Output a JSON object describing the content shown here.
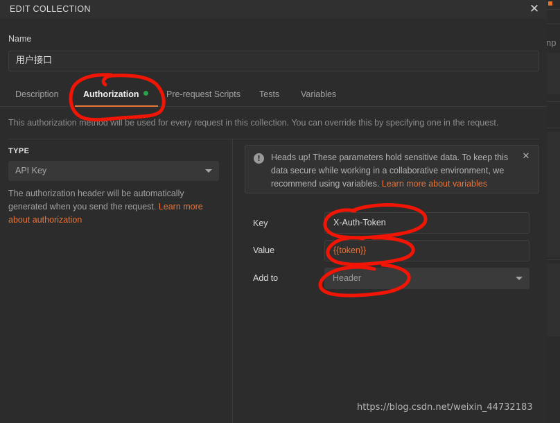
{
  "window": {
    "title": "EDIT COLLECTION",
    "close_icon": "close-icon",
    "close_glyph": "✕"
  },
  "name_section": {
    "label": "Name",
    "value": "用户接口",
    "placeholder": "Collection name"
  },
  "tabs": [
    {
      "label": "Description",
      "active": false,
      "has_dot": false
    },
    {
      "label": "Authorization",
      "active": true,
      "has_dot": true
    },
    {
      "label": "Pre-request Scripts",
      "active": false,
      "has_dot": false
    },
    {
      "label": "Tests",
      "active": false,
      "has_dot": false
    },
    {
      "label": "Variables",
      "active": false,
      "has_dot": false
    }
  ],
  "helper_note": "This authorization method will be used for every request in this collection. You can override this by specifying one in the request.",
  "left_pane": {
    "type_label": "TYPE",
    "type_value": "API Key",
    "type_caret_icon": "chevron-down-icon",
    "description_text": "The authorization header will be automatically generated when you send the request. ",
    "description_link": "Learn more about authorization"
  },
  "banner": {
    "icon": "alert-exclamation-icon",
    "icon_glyph": "!",
    "text": "Heads up! These parameters hold sensitive data. To keep this data secure while working in a collaborative environment, we recommend using variables. ",
    "link": "Learn more about variables",
    "close_icon": "close-icon",
    "close_glyph": "✕"
  },
  "form": {
    "key": {
      "label": "Key",
      "value": "X-Auth-Token",
      "placeholder": "Key"
    },
    "value": {
      "label": "Value",
      "value": "{{token}}",
      "placeholder": "Value"
    },
    "add_to": {
      "label": "Add to",
      "value": "Header",
      "caret_icon": "chevron-down-icon"
    }
  },
  "watermark": "https://blog.csdn.net/weixin_44732183",
  "background_app": {
    "partial_text": "np"
  },
  "colors": {
    "accent_orange": "#e8743a",
    "tab_underline": "#e8793a",
    "status_green": "#2aa049",
    "annotation_red": "#f01505",
    "panel_bg": "#2c2c2c",
    "titlebar_bg": "#303030",
    "input_bg": "#2f2f2f",
    "select_bg": "#3a3a3a"
  }
}
